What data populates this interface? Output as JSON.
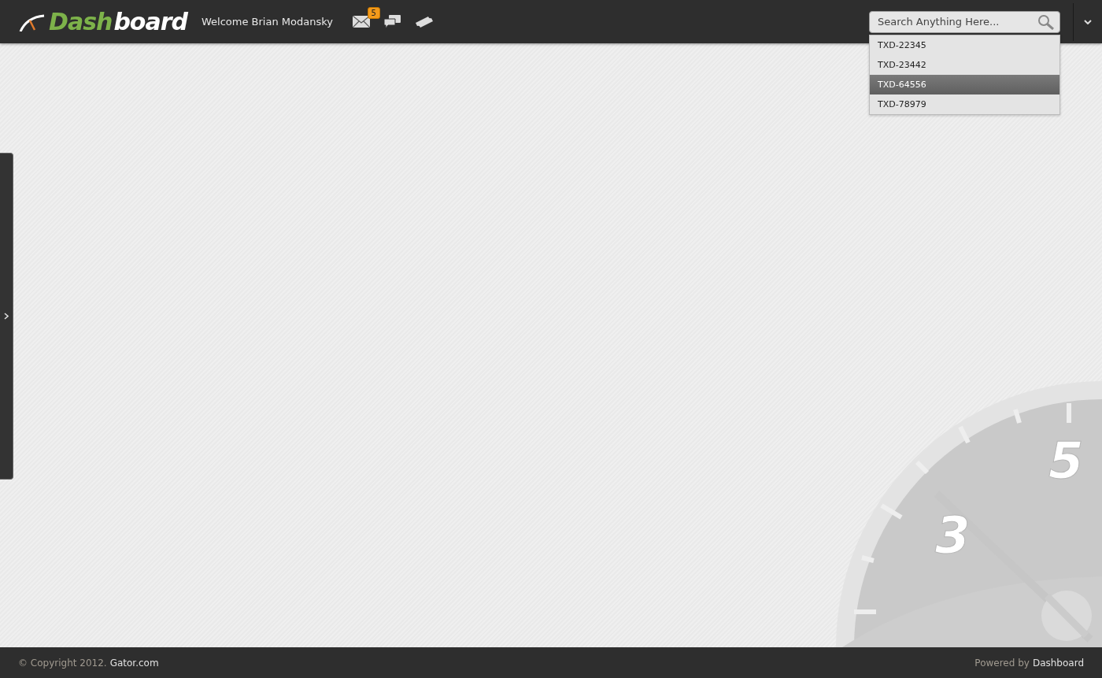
{
  "header": {
    "logo": {
      "part_1": "Dash",
      "part_2": "board"
    },
    "welcome": "Welcome Brian Modansky",
    "icons": [
      {
        "kind": "mail",
        "badge": "5"
      },
      {
        "kind": "chat"
      },
      {
        "kind": "ticket"
      }
    ]
  },
  "search": {
    "placeholder": "Search Anything Here...",
    "results": [
      {
        "label": "TXD-22345",
        "selected": false
      },
      {
        "label": "TXD-23442",
        "selected": false
      },
      {
        "label": "TXD-64556",
        "selected": true
      },
      {
        "label": "TXD-78979",
        "selected": false
      }
    ]
  },
  "gauge": {
    "labels": [
      "3",
      "5"
    ]
  },
  "footer": {
    "copyright": "© Copyright 2012.",
    "site": "Gator.com",
    "powered_by": "Powered by",
    "brand": "Dashboard"
  }
}
